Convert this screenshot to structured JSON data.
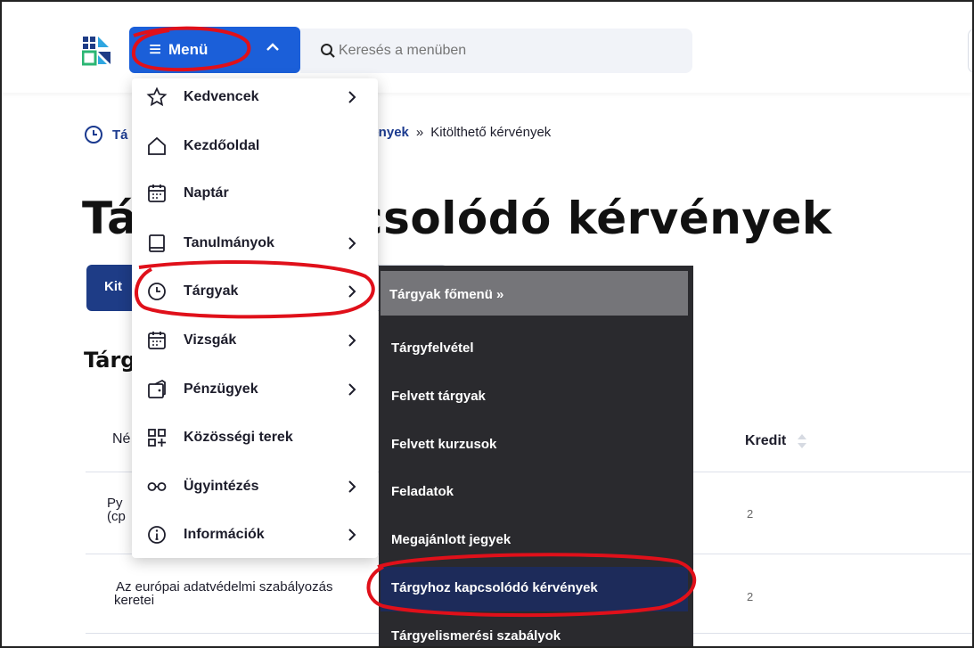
{
  "header": {
    "menu_label": "Menü",
    "search_placeholder": "Keresés a menüben"
  },
  "breadcrumb": {
    "start_visible": "Tá",
    "middle_visible": "vények",
    "separator": "»",
    "current": "Kitölthető kérvények"
  },
  "page": {
    "title_left_visible": "Tá",
    "title_right_visible": "csolódó kérvények",
    "tab_label_visible": "Kit",
    "section_title_visible": "Tárg"
  },
  "table": {
    "col_name_visible": "Né",
    "col_kredit": "Kredit",
    "rows": [
      {
        "name_line1_visible": "Py",
        "name_line2_visible": "(cp",
        "kredit": "2"
      },
      {
        "name_line1_visible": "Az európai adatvédelmi szabályozás",
        "name_line2_visible": "keretei",
        "kredit": "2"
      }
    ]
  },
  "dropdown": {
    "items": [
      {
        "label": "Kedvencek",
        "icon": "star-icon",
        "has_submenu": true
      },
      {
        "label": "Kezdőoldal",
        "icon": "home-icon",
        "has_submenu": false
      },
      {
        "label": "Naptár",
        "icon": "calendar-icon",
        "has_submenu": false
      },
      {
        "label": "Tanulmányok",
        "icon": "book-icon",
        "has_submenu": true
      },
      {
        "label": "Tárgyak",
        "icon": "clock-icon",
        "has_submenu": true
      },
      {
        "label": "Vizsgák",
        "icon": "calendar-icon",
        "has_submenu": true
      },
      {
        "label": "Pénzügyek",
        "icon": "wallet-icon",
        "has_submenu": true
      },
      {
        "label": "Közösségi terek",
        "icon": "grid-plus-icon",
        "has_submenu": false
      },
      {
        "label": "Ügyintézés",
        "icon": "glasses-icon",
        "has_submenu": true
      },
      {
        "label": "Információk",
        "icon": "info-icon",
        "has_submenu": true
      }
    ]
  },
  "submenu": {
    "header": "Tárgyak főmenü »",
    "items": [
      {
        "label": "Tárgyfelvétel"
      },
      {
        "label": "Felvett tárgyak"
      },
      {
        "label": "Felvett kurzusok"
      },
      {
        "label": "Feladatok"
      },
      {
        "label": "Megajánlott jegyek"
      },
      {
        "label": "Tárgyhoz kapcsolódó kérvények"
      },
      {
        "label": "Tárgyelismerési szabályok"
      }
    ]
  },
  "colors": {
    "brand_blue": "#1b5fd9",
    "navy": "#1e3c86",
    "submenu_bg": "#2a2a2e",
    "annotation_red": "#e0101a"
  }
}
